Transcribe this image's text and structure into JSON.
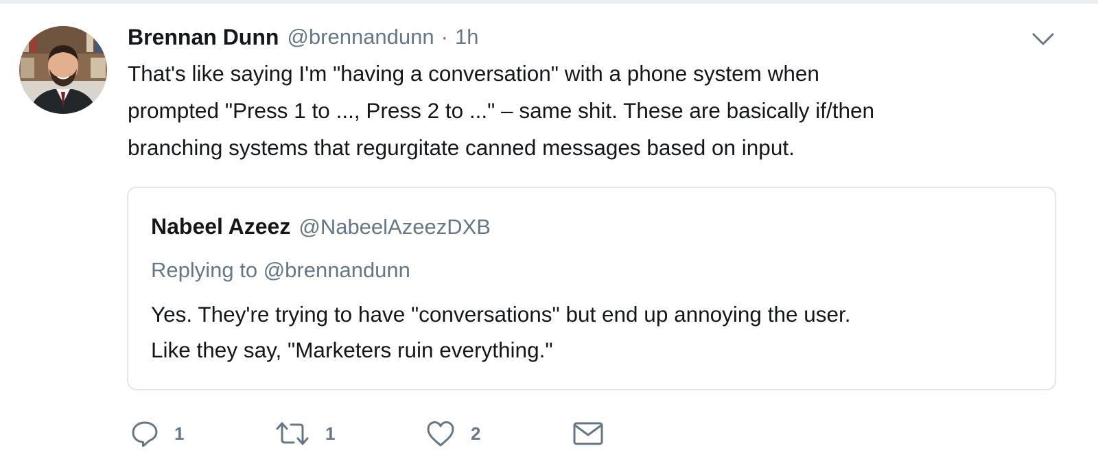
{
  "tweet": {
    "author": {
      "name": "Brennan Dunn",
      "handle": "@brennandunn",
      "avatar": "profile-photo"
    },
    "separator": "·",
    "timestamp": "1h",
    "text_lines": [
      "That's like saying I'm \"having a conversation\" with a phone system when",
      "prompted \"Press 1 to ..., Press 2 to ...\" – same shit. These are basically if/then",
      "branching systems that regurgitate canned messages based on input."
    ],
    "quoted": {
      "name": "Nabeel Azeez",
      "handle": "@NabeelAzeezDXB",
      "replying_to": "Replying to @brennandunn",
      "text_lines": [
        "Yes. They're trying to have \"conversations\" but end up annoying the user.",
        "Like they say, \"Marketers ruin everything.\""
      ]
    },
    "actions": {
      "reply": {
        "icon": "reply-icon",
        "count": "1"
      },
      "retweet": {
        "icon": "retweet-icon",
        "count": "1"
      },
      "like": {
        "icon": "heart-icon",
        "count": "2"
      },
      "dm": {
        "icon": "envelope-icon"
      }
    }
  },
  "colors": {
    "text": "#14171a",
    "secondary": "#657786",
    "border": "#e1e8ed"
  }
}
